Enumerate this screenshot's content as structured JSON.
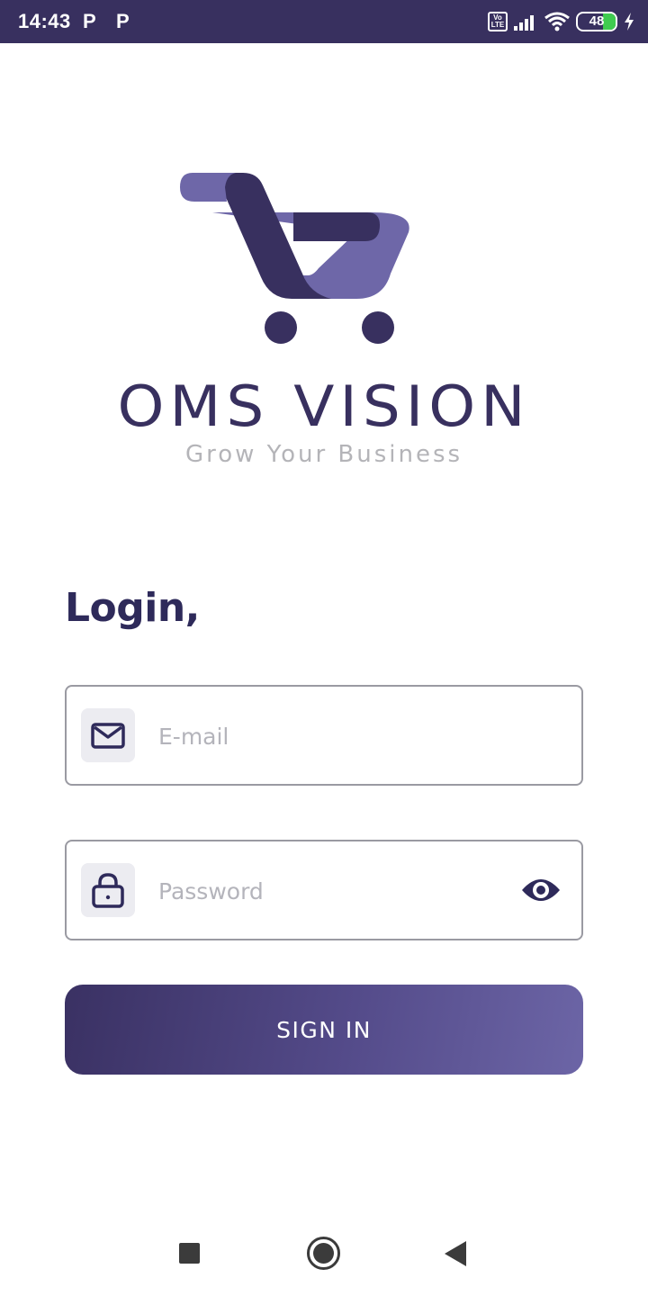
{
  "status_bar": {
    "time": "14:43",
    "notification_icons": [
      "P",
      "P"
    ],
    "volte_label": "Vo LTE",
    "battery_level": "48"
  },
  "brand": {
    "name": "OMS VISION",
    "tagline": "Grow Your Business",
    "colors": {
      "primary": "#38305f",
      "secondary": "#6e67a8",
      "tagline": "#b4b4b8"
    }
  },
  "login": {
    "title": "Login,",
    "email": {
      "placeholder": "E-mail",
      "value": "",
      "icon": "mail-icon"
    },
    "password": {
      "placeholder": "Password",
      "value": "",
      "icon": "lock-icon",
      "toggle_icon": "eye-icon"
    },
    "submit_label": "SIGN IN"
  },
  "nav": {
    "recent": "square-icon",
    "home": "circle-icon",
    "back": "triangle-icon"
  }
}
